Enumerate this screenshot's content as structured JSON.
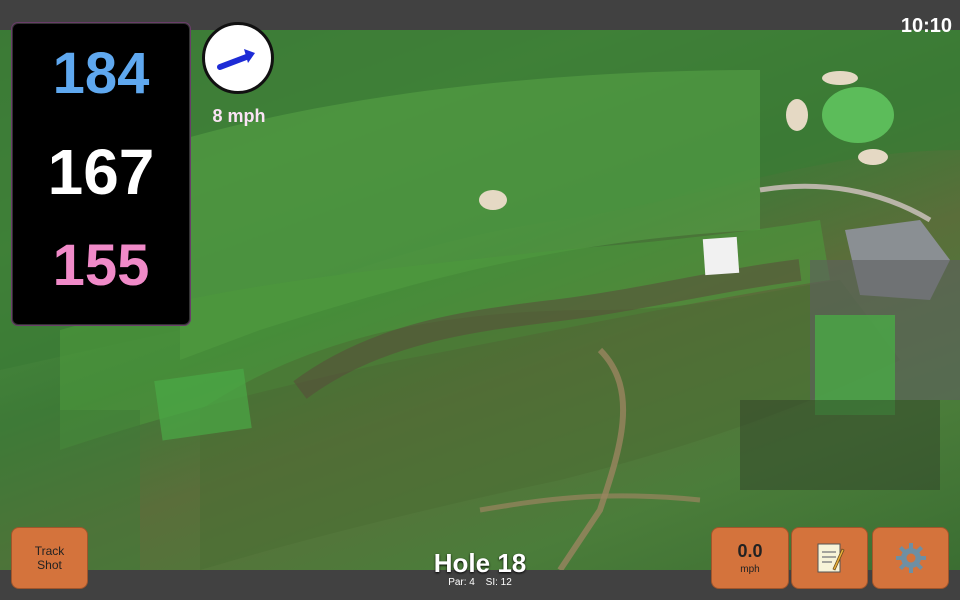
{
  "status": {
    "time": "10:10"
  },
  "distances": {
    "back": "184",
    "middle": "167",
    "front": "155"
  },
  "wind": {
    "speed_label": "8 mph",
    "icon": "wind-direction-arrow-icon"
  },
  "hole": {
    "title": "Hole 18",
    "par_label": "Par: 4",
    "si_label": "SI: 12"
  },
  "buttons": {
    "track_shot_line1": "Track",
    "track_shot_line2": "Shot",
    "speed_value": "0.0",
    "speed_unit": "mph",
    "notes_icon": "notes-icon",
    "settings_icon": "gear-icon"
  },
  "colors": {
    "back": "#5fa8ef",
    "middle": "#ffffff",
    "front": "#f08ac8",
    "button": "#d4733c"
  }
}
